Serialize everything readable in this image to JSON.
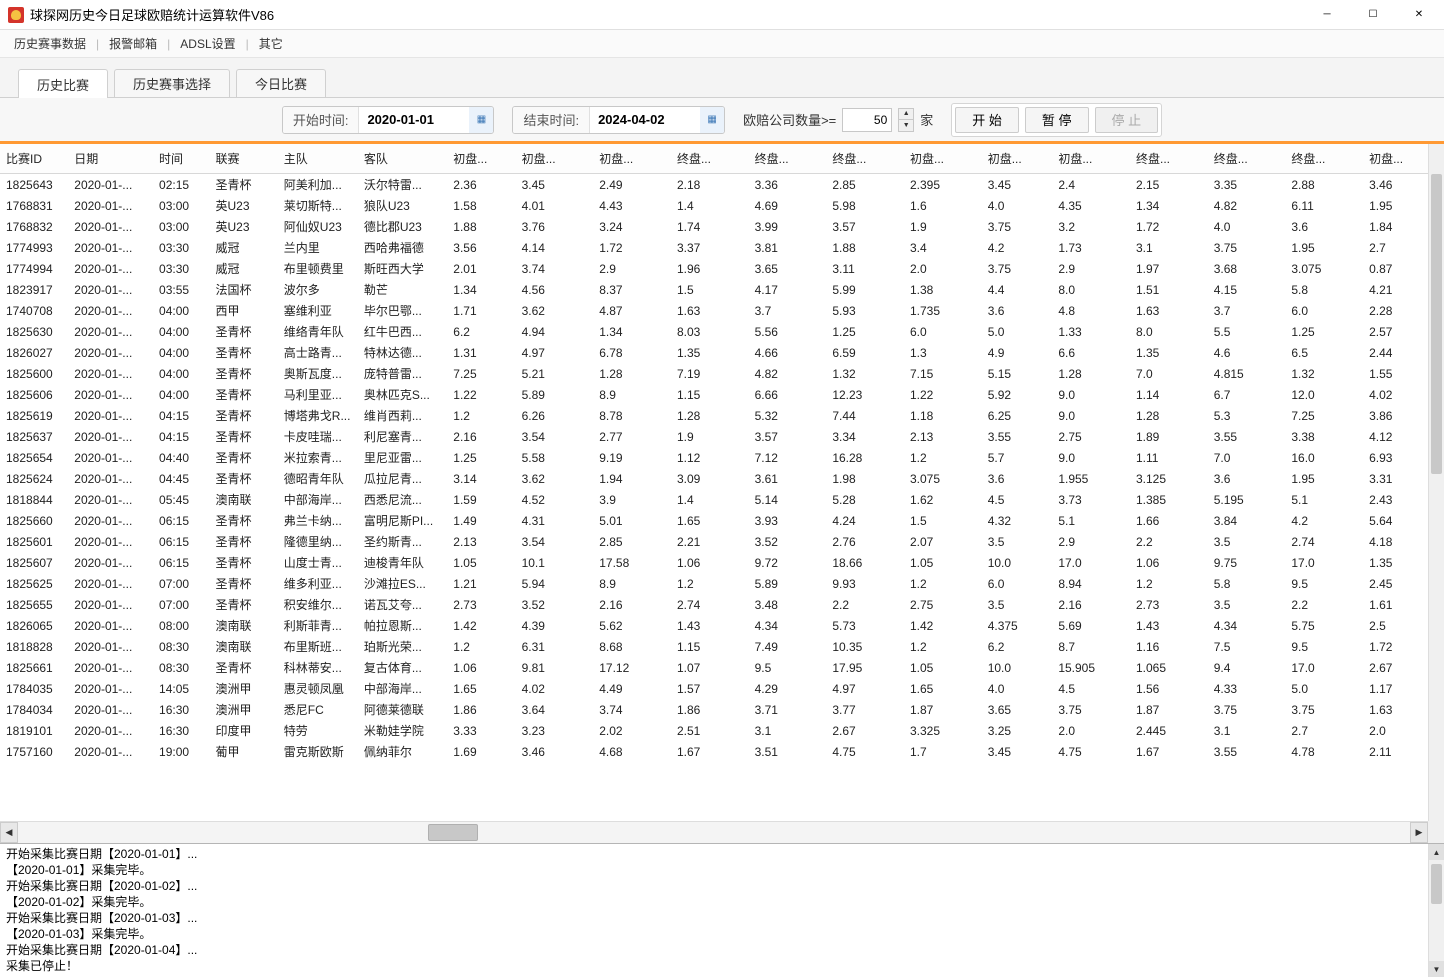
{
  "window": {
    "title": "球探网历史今日足球欧赔统计运算软件V86"
  },
  "menu": {
    "items": [
      "历史赛事数据",
      "报警邮箱",
      "ADSL设置",
      "其它"
    ]
  },
  "tabs": {
    "items": [
      "历史比赛",
      "历史赛事选择",
      "今日比赛"
    ],
    "active": 0
  },
  "toolbar": {
    "start_label": "开始时间:",
    "start_value": "2020-01-01",
    "end_label": "结束时间:",
    "end_value": "2024-04-02",
    "count_label": "欧赔公司数量>=",
    "count_value": "50",
    "count_unit": "家",
    "btn_start": "开 始",
    "btn_pause": "暂 停",
    "btn_stop": "停 止"
  },
  "columns": [
    "比赛ID",
    "日期",
    "时间",
    "联赛",
    "主队",
    "客队",
    "初盘...",
    "初盘...",
    "初盘...",
    "终盘...",
    "终盘...",
    "终盘...",
    "初盘...",
    "初盘...",
    "初盘...",
    "终盘...",
    "终盘...",
    "终盘...",
    "初盘..."
  ],
  "cw": [
    58,
    72,
    48,
    58,
    68,
    76,
    58,
    66,
    66,
    66,
    66,
    66,
    66,
    60,
    66,
    66,
    66,
    66,
    55
  ],
  "rows": [
    [
      "1825643",
      "2020-01-...",
      "02:15",
      "圣青杯",
      "阿美利加...",
      "沃尔特雷...",
      "2.36",
      "3.45",
      "2.49",
      "2.18",
      "3.36",
      "2.85",
      "2.395",
      "3.45",
      "2.4",
      "2.15",
      "3.35",
      "2.88",
      "3.46"
    ],
    [
      "1768831",
      "2020-01-...",
      "03:00",
      "英U23",
      "莱切斯特...",
      "狼队U23",
      "1.58",
      "4.01",
      "4.43",
      "1.4",
      "4.69",
      "5.98",
      "1.6",
      "4.0",
      "4.35",
      "1.34",
      "4.82",
      "6.11",
      "1.95"
    ],
    [
      "1768832",
      "2020-01-...",
      "03:00",
      "英U23",
      "阿仙奴U23",
      "德比郡U23",
      "1.88",
      "3.76",
      "3.24",
      "1.74",
      "3.99",
      "3.57",
      "1.9",
      "3.75",
      "3.2",
      "1.72",
      "4.0",
      "3.6",
      "1.84"
    ],
    [
      "1774993",
      "2020-01-...",
      "03:30",
      "威冠",
      "兰内里",
      "西哈弗福德",
      "3.56",
      "4.14",
      "1.72",
      "3.37",
      "3.81",
      "1.88",
      "3.4",
      "4.2",
      "1.73",
      "3.1",
      "3.75",
      "1.95",
      "2.7"
    ],
    [
      "1774994",
      "2020-01-...",
      "03:30",
      "威冠",
      "布里顿费里",
      "斯旺西大学",
      "2.01",
      "3.74",
      "2.9",
      "1.96",
      "3.65",
      "3.11",
      "2.0",
      "3.75",
      "2.9",
      "1.97",
      "3.68",
      "3.075",
      "0.87"
    ],
    [
      "1823917",
      "2020-01-...",
      "03:55",
      "法国杯",
      "波尔多",
      "勒芒",
      "1.34",
      "4.56",
      "8.37",
      "1.5",
      "4.17",
      "5.99",
      "1.38",
      "4.4",
      "8.0",
      "1.51",
      "4.15",
      "5.8",
      "4.21"
    ],
    [
      "1740708",
      "2020-01-...",
      "04:00",
      "西甲",
      "塞维利亚",
      "毕尔巴鄂...",
      "1.71",
      "3.62",
      "4.87",
      "1.63",
      "3.7",
      "5.93",
      "1.735",
      "3.6",
      "4.8",
      "1.63",
      "3.7",
      "6.0",
      "2.28"
    ],
    [
      "1825630",
      "2020-01-...",
      "04:00",
      "圣青杯",
      "维络青年队",
      "红牛巴西...",
      "6.2",
      "4.94",
      "1.34",
      "8.03",
      "5.56",
      "1.25",
      "6.0",
      "5.0",
      "1.33",
      "8.0",
      "5.5",
      "1.25",
      "2.57"
    ],
    [
      "1826027",
      "2020-01-...",
      "04:00",
      "圣青杯",
      "高士路青...",
      "特林达德...",
      "1.31",
      "4.97",
      "6.78",
      "1.35",
      "4.66",
      "6.59",
      "1.3",
      "4.9",
      "6.6",
      "1.35",
      "4.6",
      "6.5",
      "2.44"
    ],
    [
      "1825600",
      "2020-01-...",
      "04:00",
      "圣青杯",
      "奥斯瓦度...",
      "庞特普雷...",
      "7.25",
      "5.21",
      "1.28",
      "7.19",
      "4.82",
      "1.32",
      "7.15",
      "5.15",
      "1.28",
      "7.0",
      "4.815",
      "1.32",
      "1.55"
    ],
    [
      "1825606",
      "2020-01-...",
      "04:00",
      "圣青杯",
      "马利里亚...",
      "奥林匹克S...",
      "1.22",
      "5.89",
      "8.9",
      "1.15",
      "6.66",
      "12.23",
      "1.22",
      "5.92",
      "9.0",
      "1.14",
      "6.7",
      "12.0",
      "4.02"
    ],
    [
      "1825619",
      "2020-01-...",
      "04:15",
      "圣青杯",
      "博塔弗戈R...",
      "维肖西莉...",
      "1.2",
      "6.26",
      "8.78",
      "1.28",
      "5.32",
      "7.44",
      "1.18",
      "6.25",
      "9.0",
      "1.28",
      "5.3",
      "7.25",
      "3.86"
    ],
    [
      "1825637",
      "2020-01-...",
      "04:15",
      "圣青杯",
      "卡皮哇瑞...",
      "利尼塞青...",
      "2.16",
      "3.54",
      "2.77",
      "1.9",
      "3.57",
      "3.34",
      "2.13",
      "3.55",
      "2.75",
      "1.89",
      "3.55",
      "3.38",
      "4.12"
    ],
    [
      "1825654",
      "2020-01-...",
      "04:40",
      "圣青杯",
      "米拉索青...",
      "里尼亚雷...",
      "1.25",
      "5.58",
      "9.19",
      "1.12",
      "7.12",
      "16.28",
      "1.2",
      "5.7",
      "9.0",
      "1.11",
      "7.0",
      "16.0",
      "6.93"
    ],
    [
      "1825624",
      "2020-01-...",
      "04:45",
      "圣青杯",
      "德昭青年队",
      "瓜拉尼青...",
      "3.14",
      "3.62",
      "1.94",
      "3.09",
      "3.61",
      "1.98",
      "3.075",
      "3.6",
      "1.955",
      "3.125",
      "3.6",
      "1.95",
      "3.31"
    ],
    [
      "1818844",
      "2020-01-...",
      "05:45",
      "澳南联",
      "中部海岸...",
      "西悉尼流...",
      "1.59",
      "4.52",
      "3.9",
      "1.4",
      "5.14",
      "5.28",
      "1.62",
      "4.5",
      "3.73",
      "1.385",
      "5.195",
      "5.1",
      "2.43"
    ],
    [
      "1825660",
      "2020-01-...",
      "06:15",
      "圣青杯",
      "弗兰卡纳...",
      "富明尼斯PI...",
      "1.49",
      "4.31",
      "5.01",
      "1.65",
      "3.93",
      "4.24",
      "1.5",
      "4.32",
      "5.1",
      "1.66",
      "3.84",
      "4.2",
      "5.64"
    ],
    [
      "1825601",
      "2020-01-...",
      "06:15",
      "圣青杯",
      "隆德里纳...",
      "圣约斯青...",
      "2.13",
      "3.54",
      "2.85",
      "2.21",
      "3.52",
      "2.76",
      "2.07",
      "3.5",
      "2.9",
      "2.2",
      "3.5",
      "2.74",
      "4.18"
    ],
    [
      "1825607",
      "2020-01-...",
      "06:15",
      "圣青杯",
      "山度士青...",
      "迪梭青年队",
      "1.05",
      "10.1",
      "17.58",
      "1.06",
      "9.72",
      "18.66",
      "1.05",
      "10.0",
      "17.0",
      "1.06",
      "9.75",
      "17.0",
      "1.35"
    ],
    [
      "1825625",
      "2020-01-...",
      "07:00",
      "圣青杯",
      "维多利亚...",
      "沙滩拉ES...",
      "1.21",
      "5.94",
      "8.9",
      "1.2",
      "5.89",
      "9.93",
      "1.2",
      "6.0",
      "8.94",
      "1.2",
      "5.8",
      "9.5",
      "2.45"
    ],
    [
      "1825655",
      "2020-01-...",
      "07:00",
      "圣青杯",
      "积安维尔...",
      "诺瓦艾夸...",
      "2.73",
      "3.52",
      "2.16",
      "2.74",
      "3.48",
      "2.2",
      "2.75",
      "3.5",
      "2.16",
      "2.73",
      "3.5",
      "2.2",
      "1.61"
    ],
    [
      "1826065",
      "2020-01-...",
      "08:00",
      "澳南联",
      "利斯菲青...",
      "帕拉恩斯...",
      "1.42",
      "4.39",
      "5.62",
      "1.43",
      "4.34",
      "5.73",
      "1.42",
      "4.375",
      "5.69",
      "1.43",
      "4.34",
      "5.75",
      "2.5"
    ],
    [
      "1818828",
      "2020-01-...",
      "08:30",
      "澳南联",
      "布里斯班...",
      "珀斯光荣...",
      "1.2",
      "6.31",
      "8.68",
      "1.15",
      "7.49",
      "10.35",
      "1.2",
      "6.2",
      "8.7",
      "1.16",
      "7.5",
      "9.5",
      "1.72"
    ],
    [
      "1825661",
      "2020-01-...",
      "08:30",
      "圣青杯",
      "科林蒂安...",
      "复古体育...",
      "1.06",
      "9.81",
      "17.12",
      "1.07",
      "9.5",
      "17.95",
      "1.05",
      "10.0",
      "15.905",
      "1.065",
      "9.4",
      "17.0",
      "2.67"
    ],
    [
      "1784035",
      "2020-01-...",
      "14:05",
      "澳洲甲",
      "惠灵顿凤凰",
      "中部海岸...",
      "1.65",
      "4.02",
      "4.49",
      "1.57",
      "4.29",
      "4.97",
      "1.65",
      "4.0",
      "4.5",
      "1.56",
      "4.33",
      "5.0",
      "1.17"
    ],
    [
      "1784034",
      "2020-01-...",
      "16:30",
      "澳洲甲",
      "悉尼FC",
      "阿德莱德联",
      "1.86",
      "3.64",
      "3.74",
      "1.86",
      "3.71",
      "3.77",
      "1.87",
      "3.65",
      "3.75",
      "1.87",
      "3.75",
      "3.75",
      "1.63"
    ],
    [
      "1819101",
      "2020-01-...",
      "16:30",
      "印度甲",
      "特劳",
      "米勒娃学院",
      "3.33",
      "3.23",
      "2.02",
      "2.51",
      "3.1",
      "2.67",
      "3.325",
      "3.25",
      "2.0",
      "2.445",
      "3.1",
      "2.7",
      "2.0"
    ],
    [
      "1757160",
      "2020-01-...",
      "19:00",
      "葡甲",
      "雷克斯欧斯",
      "佩纳菲尔",
      "1.69",
      "3.46",
      "4.68",
      "1.67",
      "3.51",
      "4.75",
      "1.7",
      "3.45",
      "4.75",
      "1.67",
      "3.55",
      "4.78",
      "2.11"
    ]
  ],
  "log": {
    "lines": [
      "开始采集比赛日期【2020-01-01】...",
      "【2020-01-01】采集完毕。",
      "开始采集比赛日期【2020-01-02】...",
      "【2020-01-02】采集完毕。",
      "开始采集比赛日期【2020-01-03】...",
      "【2020-01-03】采集完毕。",
      "开始采集比赛日期【2020-01-04】...",
      "采集已停止！"
    ]
  }
}
